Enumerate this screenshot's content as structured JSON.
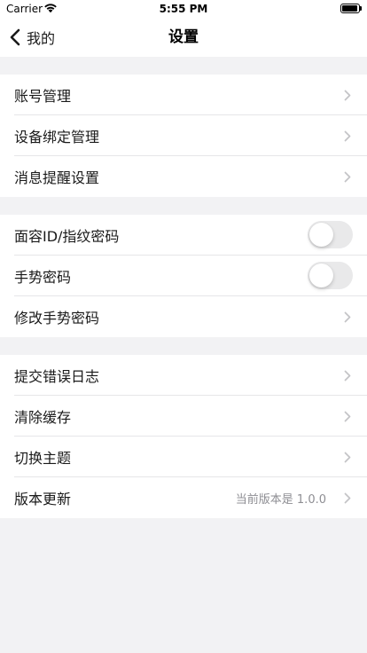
{
  "status_bar": {
    "carrier": "Carrier",
    "time": "5:55 PM"
  },
  "nav": {
    "back_label": "我的",
    "title": "设置"
  },
  "groups": [
    {
      "rows": [
        {
          "label": "账号管理"
        },
        {
          "label": "设备绑定管理"
        },
        {
          "label": "消息提醒设置"
        }
      ]
    },
    {
      "rows": [
        {
          "label": "面容ID/指纹密码",
          "toggle": "off"
        },
        {
          "label": "手势密码",
          "toggle": "off"
        },
        {
          "label": "修改手势密码"
        }
      ]
    },
    {
      "rows": [
        {
          "label": "提交错误日志"
        },
        {
          "label": "清除缓存"
        },
        {
          "label": "切换主题"
        },
        {
          "label": "版本更新",
          "value": "当前版本是 1.0.0"
        }
      ]
    }
  ],
  "icons": {
    "back": "chevron-left-icon",
    "disclosure": "chevron-right-icon",
    "wifi": "wifi-icon",
    "battery": "battery-icon"
  },
  "colors": {
    "background": "#f2f2f4",
    "cell": "#ffffff",
    "chevron": "#c4c4c7",
    "secondary_text": "#8e8e93",
    "toggle_off": "#e9e9ea"
  }
}
